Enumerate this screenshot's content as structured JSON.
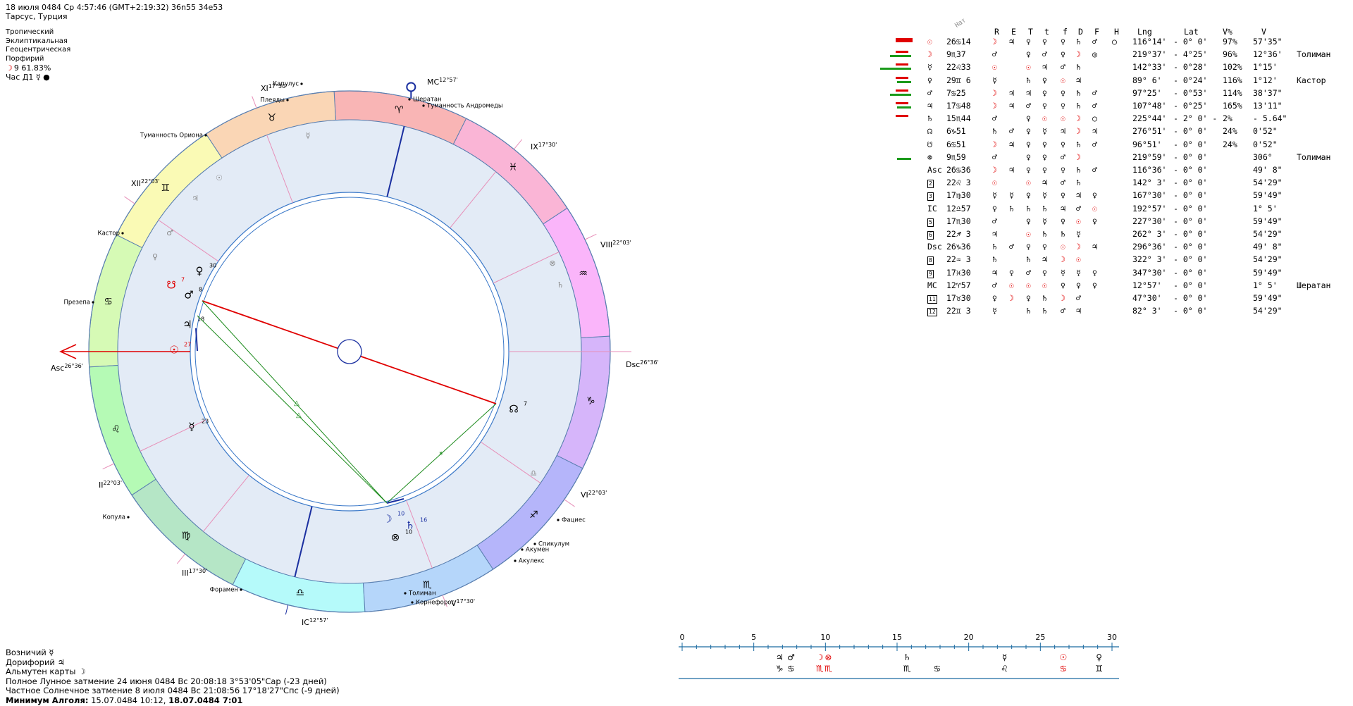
{
  "header": {
    "line1": "18 июля 0484  Ср   4:57:46 (GMT+2:19:32) 36n55  34e53",
    "line2": "Тарсус, Турция",
    "lines": [
      "Тропический",
      "Эклиптикальная",
      "Геоцентрическая",
      "Порфирий"
    ],
    "moon_phase": "☽  9 61.83%",
    "hour_ruler": "Час Д1 ☿ ●"
  },
  "bottom": {
    "lines": [
      "Возничий ☿",
      "Дорифорий ♃",
      "Альмутен карты ☽",
      "Полное Лунное затмение 24 июня 0484 Вс 20:08:18  3°53'05\"Сар (-23 дней)",
      "Частное Солнечное затмение 8 июля 0484 Вс 21:08:56 17°18'27\"Спс (-9 дней)"
    ],
    "algol_label": "Минимум Алголя:",
    "algol_value": " 15.07.0484 10:12,  ",
    "algol_bold": "18.07.0484  7:01"
  },
  "chart": {
    "zodiac_signs": [
      "♈",
      "♉",
      "♊",
      "♋",
      "♌",
      "♍",
      "♎",
      "♏",
      "♐",
      "♑",
      "♒",
      "♓"
    ],
    "house_labels": [
      {
        "text": "Asc",
        "deg": "26°36'"
      },
      {
        "text": "II",
        "deg": "22°03'"
      },
      {
        "text": "III",
        "deg": "17°30'"
      },
      {
        "text": "IC",
        "deg": "12°57'"
      },
      {
        "text": "V",
        "deg": "17°30'"
      },
      {
        "text": "VI",
        "deg": "22°03'"
      },
      {
        "text": "Dsc",
        "deg": "26°36'"
      },
      {
        "text": "VIII",
        "deg": "22°03'"
      },
      {
        "text": "IX",
        "deg": "17°30'"
      },
      {
        "text": "MC",
        "deg": "12°57'"
      },
      {
        "text": "XI",
        "deg": "17°30'"
      },
      {
        "text": "XII",
        "deg": "22°03'"
      }
    ],
    "fixed_stars": [
      "Капулус",
      "Плеяды",
      "Шератан",
      "Туманность Андромеды",
      "Туманность Ориона",
      "Кастор",
      "Презепа",
      "Копула",
      "Форамен",
      "Толиман",
      "Корнефорос",
      "Фациес",
      "Спикулум",
      "Акумен",
      "Акулекс"
    ],
    "planets": [
      {
        "glyph": "☉",
        "deg": "27"
      },
      {
        "glyph": "♃",
        "deg": "18"
      },
      {
        "glyph": "♂",
        "deg": "8"
      },
      {
        "glyph": "♀",
        "deg": "30"
      },
      {
        "glyph": "☋",
        "deg": "7"
      },
      {
        "glyph": "☿",
        "deg": "23"
      },
      {
        "glyph": "☊",
        "deg": "7"
      },
      {
        "glyph": "☽",
        "deg": "10"
      },
      {
        "glyph": "♄",
        "deg": "16"
      },
      {
        "glyph": "⊗",
        "deg": "10"
      }
    ]
  },
  "table": {
    "nat_label": "Нат",
    "headers": [
      "R",
      "E",
      "T",
      "t",
      "f",
      "D",
      "F",
      "H",
      "Lng",
      "Lat",
      "V%",
      "V"
    ],
    "rows": [
      {
        "name": "☉",
        "pos": "26♋14",
        "r": [
          "☽",
          "♃",
          "♀",
          "♀",
          "♀",
          "♄",
          "♂",
          "○"
        ],
        "lng": "116°14'",
        "lat": "- 0° 0'",
        "vp": "97%",
        "v": "57'35\"",
        "star": ""
      },
      {
        "name": "☽",
        "pos": "9♏37",
        "r": [
          "♂",
          "",
          "♀",
          "♂",
          "♀",
          "☽",
          "◎",
          ""
        ],
        "lng": "219°37'",
        "lat": "- 4°25'",
        "vp": "96%",
        "v": "12°36'",
        "star": "Толиман"
      },
      {
        "name": "☿",
        "pos": "22♌33",
        "r": [
          "☉",
          "",
          "☉",
          "♃",
          "♂",
          "♄",
          "",
          ""
        ],
        "lng": "142°33'",
        "lat": "- 0°28'",
        "vp": "102%",
        "v": "1°15'",
        "star": ""
      },
      {
        "name": "♀",
        "pos": "29♊ 6",
        "r": [
          "☿",
          "",
          "♄",
          "♀",
          "☉",
          "♃",
          "",
          ""
        ],
        "lng": "89° 6'",
        "lat": "- 0°24'",
        "vp": "116%",
        "v": "1°12'",
        "star": "Кастор"
      },
      {
        "name": "♂",
        "pos": "7♋25",
        "r": [
          "☽",
          "♃",
          "♃",
          "♀",
          "♀",
          "♄",
          "♂",
          ""
        ],
        "lng": "97°25'",
        "lat": "- 0°53'",
        "vp": "114%",
        "v": "38'37\"",
        "star": ""
      },
      {
        "name": "♃",
        "pos": "17♋48",
        "r": [
          "☽",
          "♃",
          "♂",
          "♀",
          "♀",
          "♄",
          "♂",
          ""
        ],
        "lng": "107°48'",
        "lat": "- 0°25'",
        "vp": "165%",
        "v": "13'11\"",
        "star": ""
      },
      {
        "name": "♄",
        "pos": "15♏44",
        "r": [
          "♂",
          "",
          "♀",
          "☉",
          "☉",
          "☽",
          "○",
          ""
        ],
        "lng": "225°44'",
        "lat": "- 2° 0' -",
        "vp": "2%",
        "v": "- 5.64\"",
        "star": ""
      },
      {
        "name": "☊",
        "pos": "6♑51",
        "r": [
          "♄",
          "♂",
          "♀",
          "☿",
          "♃",
          "☽",
          "♃",
          ""
        ],
        "lng": "276°51'",
        "lat": "- 0° 0'",
        "vp": "24%",
        "v": "0'52\"",
        "star": ""
      },
      {
        "name": "☋",
        "pos": "6♋51",
        "r": [
          "☽",
          "♃",
          "♀",
          "♀",
          "♀",
          "♄",
          "♂",
          ""
        ],
        "lng": "96°51'",
        "lat": "- 0° 0'",
        "vp": "24%",
        "v": "0'52\"",
        "star": ""
      },
      {
        "name": "⊗",
        "pos": "9♏59",
        "r": [
          "♂",
          "",
          "♀",
          "♀",
          "♂",
          "☽",
          "",
          ""
        ],
        "lng": "219°59'",
        "lat": "- 0° 0'",
        "vp": "",
        "v": "306°",
        "star": "Толиман"
      },
      {
        "name": "Asc",
        "pos": "26♋36",
        "r": [
          "☽",
          "♃",
          "♀",
          "♀",
          "♀",
          "♄",
          "♂",
          ""
        ],
        "lng": "116°36'",
        "lat": "- 0° 0'",
        "vp": "",
        "v": "49' 8\"",
        "star": ""
      },
      {
        "name": "2",
        "pos": "22♌ 3",
        "r": [
          "☉",
          "",
          "☉",
          "♃",
          "♂",
          "♄",
          "",
          ""
        ],
        "lng": "142° 3'",
        "lat": "- 0° 0'",
        "vp": "",
        "v": "54'29\"",
        "star": ""
      },
      {
        "name": "3",
        "pos": "17♍30",
        "r": [
          "☿",
          "☿",
          "♀",
          "☿",
          "♀",
          "♃",
          "♀",
          ""
        ],
        "lng": "167°30'",
        "lat": "- 0° 0'",
        "vp": "",
        "v": "59'49\"",
        "star": ""
      },
      {
        "name": "IC",
        "pos": "12♎57",
        "r": [
          "♀",
          "♄",
          "♄",
          "♄",
          "♃",
          "♂",
          "☉",
          ""
        ],
        "lng": "192°57'",
        "lat": "- 0° 0'",
        "vp": "",
        "v": "1° 5'",
        "star": ""
      },
      {
        "name": "5",
        "pos": "17♏30",
        "r": [
          "♂",
          "",
          "♀",
          "☿",
          "♀",
          "☉",
          "♀",
          ""
        ],
        "lng": "227°30'",
        "lat": "- 0° 0'",
        "vp": "",
        "v": "59'49\"",
        "star": ""
      },
      {
        "name": "6",
        "pos": "22♐ 3",
        "r": [
          "♃",
          "",
          "☉",
          "♄",
          "♄",
          "☿",
          "",
          ""
        ],
        "lng": "262° 3'",
        "lat": "- 0° 0'",
        "vp": "",
        "v": "54'29\"",
        "star": ""
      },
      {
        "name": "Dsc",
        "pos": "26♑36",
        "r": [
          "♄",
          "♂",
          "♀",
          "♀",
          "☉",
          "☽",
          "♃",
          ""
        ],
        "lng": "296°36'",
        "lat": "- 0° 0'",
        "vp": "",
        "v": "49' 8\"",
        "star": ""
      },
      {
        "name": "8",
        "pos": "22♒ 3",
        "r": [
          "♄",
          "",
          "♄",
          "♃",
          "☽",
          "☉",
          "",
          ""
        ],
        "lng": "322° 3'",
        "lat": "- 0° 0'",
        "vp": "",
        "v": "54'29\"",
        "star": ""
      },
      {
        "name": "9",
        "pos": "17♓30",
        "r": [
          "♃",
          "♀",
          "♂",
          "♀",
          "☿",
          "☿",
          "♀",
          ""
        ],
        "lng": "347°30'",
        "lat": "- 0° 0'",
        "vp": "",
        "v": "59'49\"",
        "star": ""
      },
      {
        "name": "MC",
        "pos": "12♈57",
        "r": [
          "♂",
          "☉",
          "☉",
          "☉",
          "♀",
          "♀",
          "♀",
          ""
        ],
        "lng": "12°57'",
        "lat": "- 0° 0'",
        "vp": "",
        "v": "1° 5'",
        "star": "Шератан"
      },
      {
        "name": "11",
        "pos": "17♉30",
        "r": [
          "♀",
          "☽",
          "♀",
          "♄",
          "☽",
          "♂",
          "",
          ""
        ],
        "lng": "47°30'",
        "lat": "- 0° 0'",
        "vp": "",
        "v": "59'49\"",
        "star": ""
      },
      {
        "name": "12",
        "pos": "22♊ 3",
        "r": [
          "☿",
          "",
          "♄",
          "♄",
          "♂",
          "♃",
          "",
          ""
        ],
        "lng": "82° 3'",
        "lat": "- 0° 0'",
        "vp": "",
        "v": "54'29\"",
        "star": ""
      }
    ],
    "bars": [
      {
        "red": 2,
        "green": 0
      },
      {
        "red": 1,
        "green": 2
      },
      {
        "red": 1,
        "green": 3
      },
      {
        "red": 1,
        "green": 1
      },
      {
        "red": 1,
        "green": 2
      },
      {
        "red": 1,
        "green": 1
      },
      {
        "red": 1,
        "green": 0
      },
      {
        "red": 0,
        "green": 0
      },
      {
        "red": 0,
        "green": 0
      },
      {
        "red": 0,
        "green": 1
      }
    ]
  },
  "scale": {
    "ticks": [
      "0",
      "5",
      "10",
      "15",
      "20",
      "25",
      "30"
    ],
    "row1": [
      {
        "deg": 6.8,
        "g": "♃"
      },
      {
        "deg": 7.6,
        "g": "♂"
      },
      {
        "deg": 9.6,
        "g": "☽"
      },
      {
        "deg": 10.2,
        "g": "⊗"
      },
      {
        "deg": 15.7,
        "g": "♄"
      },
      {
        "deg": 22.5,
        "g": "☿"
      },
      {
        "deg": 26.6,
        "g": "☉"
      },
      {
        "deg": 29.1,
        "g": "♀"
      }
    ],
    "row2": [
      {
        "deg": 6.8,
        "g": "♑"
      },
      {
        "deg": 7.6,
        "g": "♋"
      },
      {
        "deg": 9.6,
        "g": "♏"
      },
      {
        "deg": 10.2,
        "g": "♏"
      },
      {
        "deg": 15.7,
        "g": "♏"
      },
      {
        "deg": 17.8,
        "g": "♋"
      },
      {
        "deg": 22.5,
        "g": "♌"
      },
      {
        "deg": 26.6,
        "g": "♋"
      },
      {
        "deg": 29.1,
        "g": "♊"
      }
    ]
  }
}
